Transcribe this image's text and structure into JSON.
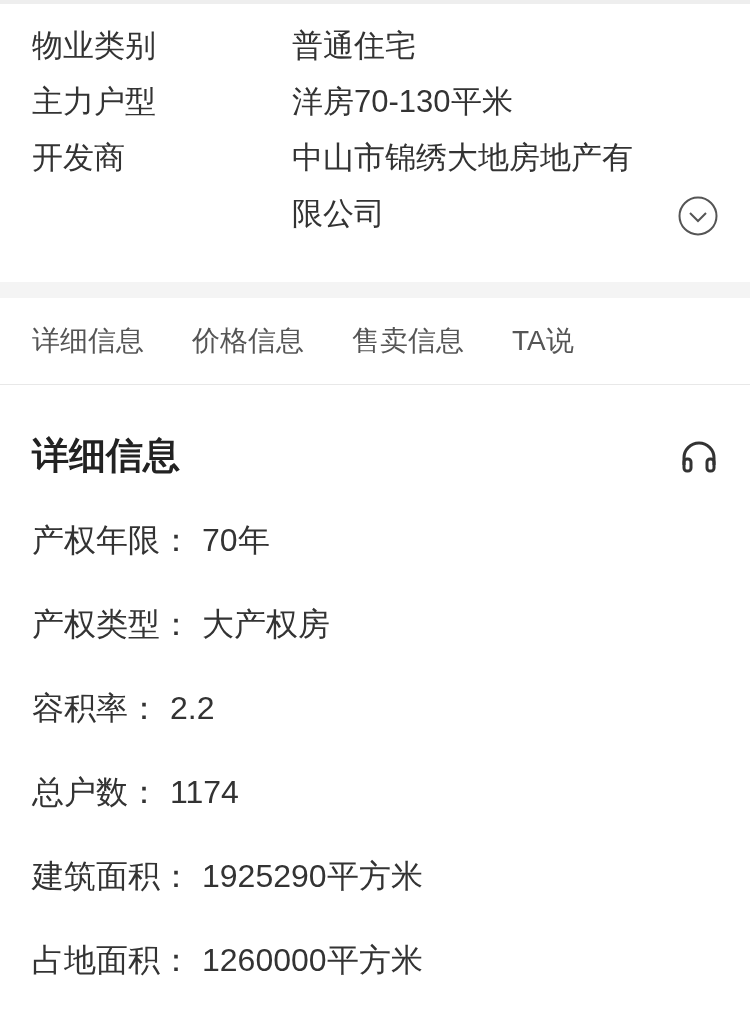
{
  "summary": {
    "rows": [
      {
        "label": "物业类别",
        "value": "普通住宅"
      },
      {
        "label": "主力户型",
        "value": "洋房70-130平米"
      },
      {
        "label": "开发商",
        "value": "中山市锦绣大地房地产有限公司"
      }
    ]
  },
  "tabs": [
    {
      "label": "详细信息"
    },
    {
      "label": "价格信息"
    },
    {
      "label": "售卖信息"
    },
    {
      "label": "TA说"
    }
  ],
  "details": {
    "title": "详细信息",
    "rows": [
      {
        "label": "产权年限：",
        "value": "70年"
      },
      {
        "label": "产权类型：",
        "value": "大产权房"
      },
      {
        "label": "容积率：",
        "value": "2.2"
      },
      {
        "label": "总户数：",
        "value": "1174"
      },
      {
        "label": "建筑面积：",
        "value": "1925290平方米"
      },
      {
        "label": "占地面积：",
        "value": "1260000平方米"
      }
    ]
  }
}
